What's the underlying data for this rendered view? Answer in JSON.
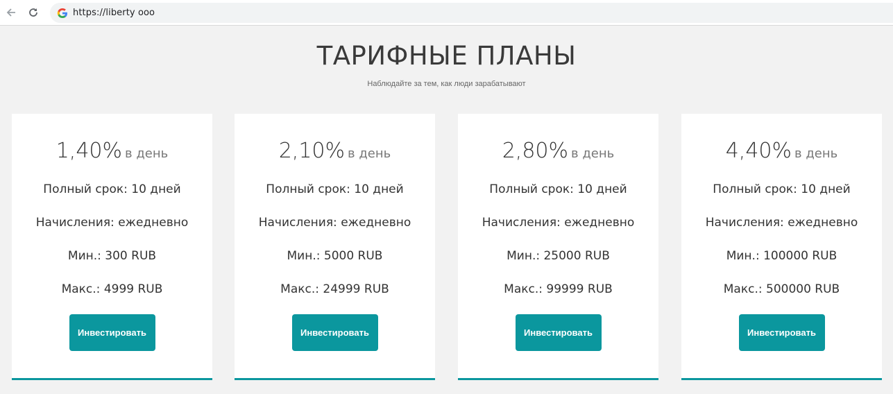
{
  "browser": {
    "url": "https://liberty ooo"
  },
  "header": {
    "title": "ТАРИФНЫЕ ПЛАНЫ",
    "subtitle": "Наблюдайте за тем, как люди зарабатывают"
  },
  "plans": [
    {
      "rate": "1,40%",
      "rate_unit": "в день",
      "term": "Полный срок: 10 дней",
      "accrual": "Начисления: ежедневно",
      "min": "Мин.: 300 RUB",
      "max": "Макс.: 4999 RUB",
      "button_label": "Инвестировать"
    },
    {
      "rate": "2,10%",
      "rate_unit": "в день",
      "term": "Полный срок: 10 дней",
      "accrual": "Начисления: ежедневно",
      "min": "Мин.: 5000 RUB",
      "max": "Макс.: 24999 RUB",
      "button_label": "Инвестировать"
    },
    {
      "rate": "2,80%",
      "rate_unit": "в день",
      "term": "Полный срок: 10 дней",
      "accrual": "Начисления: ежедневно",
      "min": "Мин.: 25000 RUB",
      "max": "Макс.: 99999 RUB",
      "button_label": "Инвестировать"
    },
    {
      "rate": "4,40%",
      "rate_unit": "в день",
      "term": "Полный срок: 10 дней",
      "accrual": "Начисления: ежедневно",
      "min": "Мин.: 100000 RUB",
      "max": "Макс.: 500000 RUB",
      "button_label": "Инвестировать"
    }
  ],
  "colors": {
    "accent": "#0b979e",
    "background": "#f2f2f2",
    "card": "#ffffff"
  },
  "icons": {
    "back": "back-arrow-icon",
    "reload": "reload-icon",
    "site": "google-icon"
  }
}
